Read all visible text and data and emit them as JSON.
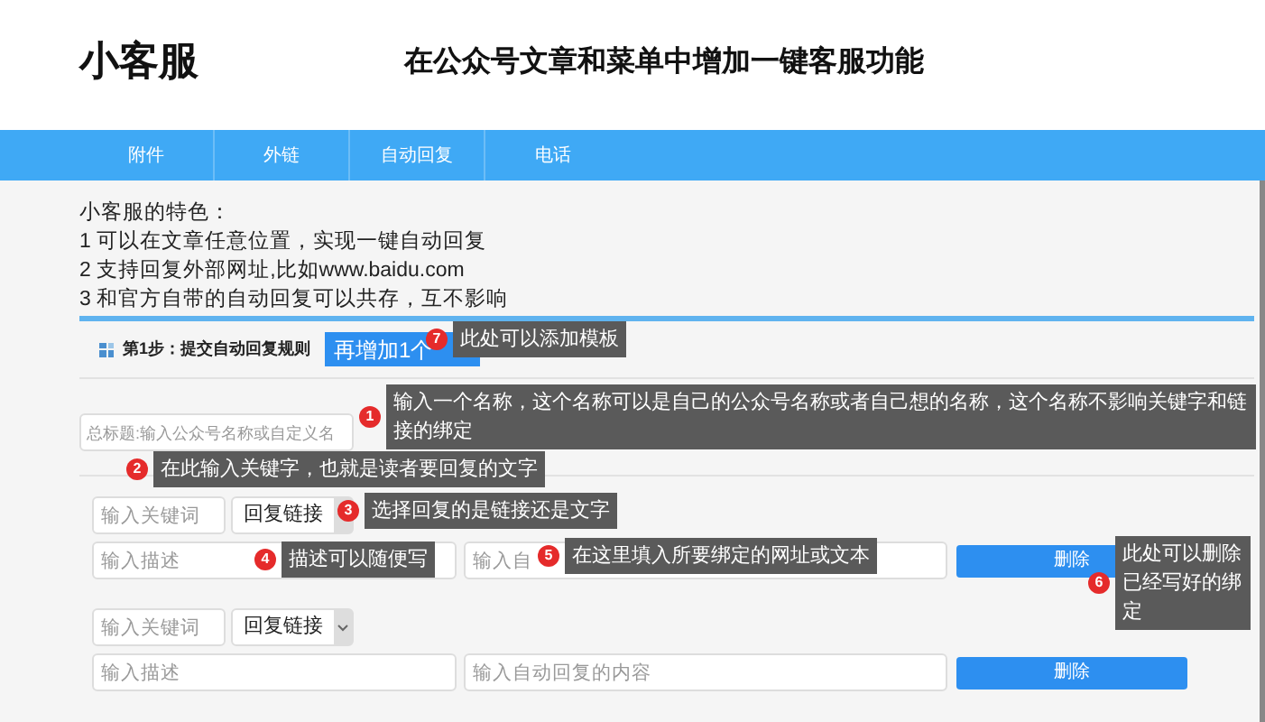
{
  "header": {
    "logo": "小客服",
    "title": "在公众号文章和菜单中增加一键客服功能"
  },
  "nav": [
    {
      "label": "附件"
    },
    {
      "label": "外链"
    },
    {
      "label": "自动回复"
    },
    {
      "label": "电话"
    }
  ],
  "features": {
    "heading": "小客服的特色：",
    "items": [
      "1 可以在文章任意位置，实现一键自动回复",
      "2 支持回复外部网址,比如www.baidu.com",
      "3 和官方自带的自动回复可以共存，互不影响"
    ]
  },
  "step": {
    "label": "第1步：提交自动回复规则",
    "add_button": "再增加1个"
  },
  "name_field": {
    "placeholder": "总标题:输入公众号名称或自定义名"
  },
  "rules": [
    {
      "keyword_placeholder": "输入关键词",
      "reply_type": "回复链接",
      "description_placeholder": "输入描述",
      "content_placeholder": "输入自",
      "delete_button": "删除"
    },
    {
      "keyword_placeholder": "输入关键词",
      "reply_type": "回复链接",
      "description_placeholder": "输入描述",
      "content_placeholder": "输入自动回复的内容",
      "delete_button": "删除"
    }
  ],
  "annotations": [
    {
      "number": "1",
      "text": "输入一个名称，这个名称可以是自己的公众号名称或者自己想的名称，这个名称不影响关键字和链接的绑定"
    },
    {
      "number": "2",
      "text": "在此输入关键字，也就是读者要回复的文字"
    },
    {
      "number": "3",
      "text": "选择回复的是链接还是文字"
    },
    {
      "number": "4",
      "text": "描述可以随便写"
    },
    {
      "number": "5",
      "text": "在这里填入所要绑定的网址或文本"
    },
    {
      "number": "6",
      "text": "此处可以删除已经写好的绑定"
    },
    {
      "number": "7",
      "text": "此处可以添加模板"
    }
  ]
}
